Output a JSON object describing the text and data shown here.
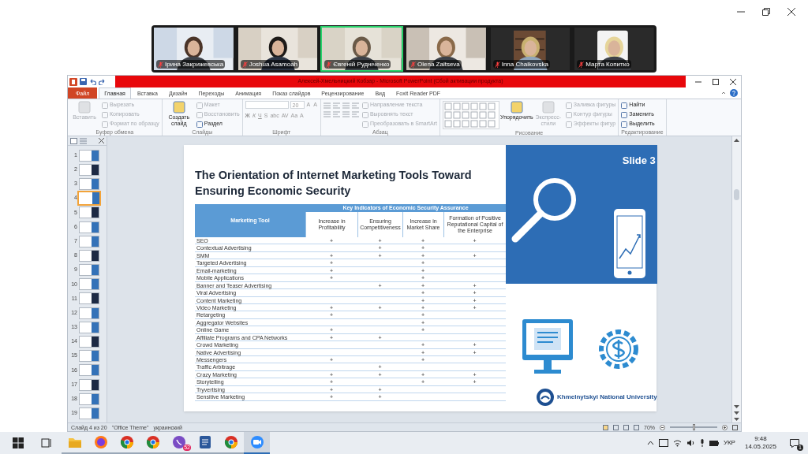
{
  "participants": [
    {
      "name": "Ірина Закрижевська",
      "muted": true,
      "selected": false
    },
    {
      "name": "Joshua Asamoah",
      "muted": true,
      "selected": false
    },
    {
      "name": "Євгеній Рудніченко",
      "muted": true,
      "selected": true
    },
    {
      "name": "Olena Zaitseva",
      "muted": true,
      "selected": false
    },
    {
      "name": "Inna Chaikovska",
      "muted": true,
      "selected": false
    },
    {
      "name": "Марта Копитко",
      "muted": true,
      "selected": false
    }
  ],
  "powerpoint": {
    "title": "Алексей-Хмельницкий Кобзар - Microsoft PowerPoint (Сбой активации продукта)",
    "tabs": [
      {
        "label": "Файл",
        "kind": "file",
        "selected": false
      },
      {
        "label": "Главная",
        "kind": "tab",
        "selected": true
      },
      {
        "label": "Вставка",
        "kind": "tab",
        "selected": false
      },
      {
        "label": "Дизайн",
        "kind": "tab",
        "selected": false
      },
      {
        "label": "Переходы",
        "kind": "tab",
        "selected": false
      },
      {
        "label": "Анимация",
        "kind": "tab",
        "selected": false
      },
      {
        "label": "Показ слайдов",
        "kind": "tab",
        "selected": false
      },
      {
        "label": "Рецензирование",
        "kind": "tab",
        "selected": false
      },
      {
        "label": "Вид",
        "kind": "tab",
        "selected": false
      },
      {
        "label": "Foxit Reader PDF",
        "kind": "tab",
        "selected": false
      }
    ],
    "groups": [
      {
        "label": "Буфер обмена",
        "items": [
          {
            "kind": "large",
            "label": "Вставить",
            "disabled": true
          },
          {
            "kind": "small",
            "label": "Вырезать",
            "disabled": true
          },
          {
            "kind": "small",
            "label": "Копировать",
            "disabled": true
          },
          {
            "kind": "small",
            "label": "Формат по образцу",
            "disabled": true
          }
        ]
      },
      {
        "label": "Слайды",
        "items": [
          {
            "kind": "large",
            "label": "Создать слайд",
            "disabled": false
          },
          {
            "kind": "small",
            "label": "Макет",
            "disabled": true
          },
          {
            "kind": "small",
            "label": "Восстановить",
            "disabled": true
          },
          {
            "kind": "small",
            "label": "Раздел",
            "disabled": false
          }
        ]
      },
      {
        "label": "Шрифт",
        "items": [
          {
            "kind": "font",
            "size": "20",
            "top_buttons": [
              "A",
              "A"
            ],
            "buttons": [
              "Ж",
              "К",
              "Ч",
              "S",
              "abc",
              "AV",
              "Aa",
              "A"
            ]
          }
        ]
      },
      {
        "label": "Абзац",
        "items": [
          {
            "kind": "para"
          },
          {
            "kind": "small",
            "label": "Направление текста",
            "disabled": true
          },
          {
            "kind": "small",
            "label": "Выровнять текст",
            "disabled": true
          },
          {
            "kind": "small",
            "label": "Преобразовать в SmartArt",
            "disabled": true
          }
        ]
      },
      {
        "label": "Рисование",
        "items": [
          {
            "kind": "gallery"
          },
          {
            "kind": "large",
            "label": "Упорядочить",
            "disabled": false
          },
          {
            "kind": "large",
            "label": "Экспресс-стили",
            "disabled": true
          },
          {
            "kind": "small",
            "label": "Заливка фигуры",
            "disabled": true
          },
          {
            "kind": "small",
            "label": "Контур фигуры",
            "disabled": true
          },
          {
            "kind": "small",
            "label": "Эффекты фигур",
            "disabled": true
          }
        ]
      },
      {
        "label": "Редактирование",
        "items": [
          {
            "kind": "small",
            "label": "Найти",
            "disabled": false
          },
          {
            "kind": "small",
            "label": "Заменить",
            "disabled": false
          },
          {
            "kind": "small",
            "label": "Выделить",
            "disabled": false
          }
        ]
      }
    ],
    "thumbnails": [
      {
        "number": "1",
        "selected": false
      },
      {
        "number": "2",
        "selected": false
      },
      {
        "number": "3",
        "selected": false
      },
      {
        "number": "4",
        "selected": true
      },
      {
        "number": "5",
        "selected": false
      },
      {
        "number": "6",
        "selected": false
      },
      {
        "number": "7",
        "selected": false
      },
      {
        "number": "8",
        "selected": false
      },
      {
        "number": "9",
        "selected": false
      },
      {
        "number": "10",
        "selected": false
      },
      {
        "number": "11",
        "selected": false
      },
      {
        "number": "12",
        "selected": false
      },
      {
        "number": "13",
        "selected": false
      },
      {
        "number": "14",
        "selected": false
      },
      {
        "number": "15",
        "selected": false
      },
      {
        "number": "16",
        "selected": false
      },
      {
        "number": "17",
        "selected": false
      },
      {
        "number": "18",
        "selected": false
      },
      {
        "number": "19",
        "selected": false
      }
    ],
    "slide": {
      "title": "The Orientation of Internet Marketing Tools Toward Ensuring Economic Security",
      "badge": "Slide 3",
      "university": "Khmelnytskyi National University",
      "table": {
        "first_column": "Marketing Tool",
        "group_heading": "Key Indicators of Economic Security Assurance",
        "columns": [
          "Increase in Profitability",
          "Ensuring Competitiveness",
          "Increase in Market Share",
          "Formation of Positive Reputational Capital of the Enterprise"
        ],
        "rows": [
          {
            "tool": "SEO",
            "cells": [
              "+",
              "+",
              "+",
              "+"
            ]
          },
          {
            "tool": "Contextual Advertising",
            "cells": [
              null,
              "+",
              "+",
              null
            ]
          },
          {
            "tool": "SMM",
            "cells": [
              "+",
              "+",
              "+",
              "+"
            ]
          },
          {
            "tool": "Targeted Advertising",
            "cells": [
              "+",
              null,
              "+",
              null
            ]
          },
          {
            "tool": "Email-marketing",
            "cells": [
              "+",
              null,
              "+",
              null
            ]
          },
          {
            "tool": "Mobile Applications",
            "cells": [
              "+",
              null,
              "+",
              null
            ]
          },
          {
            "tool": "Banner and Teaser Advertising",
            "cells": [
              null,
              "+",
              "+",
              "+"
            ]
          },
          {
            "tool": "Viral Advertising",
            "cells": [
              null,
              null,
              "+",
              "+"
            ]
          },
          {
            "tool": "Content Marketing",
            "cells": [
              null,
              null,
              "+",
              "+"
            ]
          },
          {
            "tool": "Video Marketing",
            "cells": [
              "+",
              "+",
              "+",
              "+"
            ]
          },
          {
            "tool": "Retargeting",
            "cells": [
              "+",
              null,
              "+",
              null
            ]
          },
          {
            "tool": "Aggregator Websites",
            "cells": [
              null,
              null,
              "+",
              null
            ]
          },
          {
            "tool": "Online Game",
            "cells": [
              "+",
              null,
              "+",
              null
            ]
          },
          {
            "tool": "Affiliate Programs and CPA Networks",
            "cells": [
              "+",
              "+",
              null,
              null
            ]
          },
          {
            "tool": "Crowd Marketing",
            "cells": [
              null,
              null,
              "+",
              "+"
            ]
          },
          {
            "tool": "Native Advertising",
            "cells": [
              null,
              null,
              "+",
              "+"
            ]
          },
          {
            "tool": "Messengers",
            "cells": [
              "+",
              null,
              "+",
              null
            ]
          },
          {
            "tool": "Traffic Arbitrage",
            "cells": [
              null,
              "+",
              null,
              null
            ]
          },
          {
            "tool": "Crazy Marketing",
            "cells": [
              "+",
              "+",
              "+",
              "+"
            ]
          },
          {
            "tool": "Storytelling",
            "cells": [
              "+",
              null,
              "+",
              "+"
            ]
          },
          {
            "tool": "Tryvertising",
            "cells": [
              "+",
              "+",
              null,
              null
            ]
          },
          {
            "tool": "Sensitive Marketing",
            "cells": [
              "+",
              "+",
              null,
              null
            ]
          }
        ]
      }
    },
    "status_bar": {
      "slide": "Слайд 4 из 20",
      "theme": "\"Office Theme\"",
      "language": "украинский",
      "zoom": "70%",
      "level": 0.5
    }
  },
  "taskbar": {
    "apps": [
      {
        "kind": "folder",
        "selected": false
      },
      {
        "kind": "fox",
        "selected": false
      },
      {
        "kind": "globe",
        "selected": false
      },
      {
        "kind": "globe",
        "selected": false
      },
      {
        "kind": "messenger",
        "badge": "52",
        "selected": false
      },
      {
        "kind": "document",
        "selected": false
      },
      {
        "kind": "globe",
        "selected": false
      },
      {
        "kind": "video",
        "selected": true
      }
    ],
    "language": "УКР",
    "time": "9:48",
    "date": "14.05.2025",
    "notifications": "1"
  }
}
